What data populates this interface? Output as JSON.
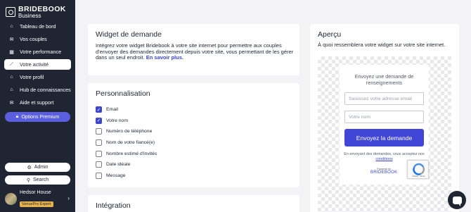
{
  "sidebar": {
    "brand": "BRIDEBOOK",
    "brand_sub": "Business",
    "items": [
      {
        "label": "Tableau de bord",
        "icon": "home-icon",
        "active": false
      },
      {
        "label": "Vos couples",
        "icon": "mail-icon",
        "active": false
      },
      {
        "label": "Votre performance",
        "icon": "calendar-icon",
        "active": false
      },
      {
        "label": "Votre activité",
        "icon": "chart-icon",
        "active": true
      },
      {
        "label": "Votre profil",
        "icon": "profile-icon",
        "active": false
      },
      {
        "label": "Hub de connaissances",
        "icon": "graduation-cap-icon",
        "active": false
      },
      {
        "label": "Aide et support",
        "icon": "help-icon",
        "active": false
      }
    ],
    "premium_label": "Options Premium",
    "admin_label": "Admin",
    "search_label": "Search",
    "user": {
      "name": "Hedsor House",
      "badge": "VenuePro Expert"
    }
  },
  "widget_card": {
    "title": "Widget de demande",
    "description": "Intégrez votre widget Bridebook à votre site internet pour permettre aux couples d'envoyer des demandes directement depuis votre site, vous permettant de les gérer dans un seul endroit.",
    "link": "En savoir plus."
  },
  "personalisation": {
    "title": "Personnalisation",
    "options": [
      {
        "label": "Email",
        "checked": true
      },
      {
        "label": "Votre nom",
        "checked": true
      },
      {
        "label": "Numéro de téléphone",
        "checked": false
      },
      {
        "label": "Nom de votre fiancé(e)",
        "checked": false
      },
      {
        "label": "Nombre estimé d'invités",
        "checked": false
      },
      {
        "label": "Date idéale",
        "checked": false
      },
      {
        "label": "Message",
        "checked": false
      }
    ]
  },
  "integration": {
    "title": "Intégration"
  },
  "preview": {
    "title": "Aperçu",
    "subtitle": "À quoi ressemblera votre widget sur votre site internet.",
    "widget": {
      "title": "Envoyez une demande de renseignements",
      "email_placeholder": "Saisissez votre adresse email",
      "name_placeholder": "Votre nom",
      "submit_label": "Envoyez la demande",
      "legal_text": "En envoyant des demandes, vous acceptez nos",
      "legal_link": "conditions",
      "powered_by": "Powered by",
      "powered_brand": "BRIDEBOOK",
      "recaptcha_text": "Privacy - Terms"
    }
  },
  "colors": {
    "sidebar_bg": "#1f2533",
    "accent": "#3c46c4",
    "premium": "#5a5fe0",
    "badge": "#e8b34b"
  }
}
